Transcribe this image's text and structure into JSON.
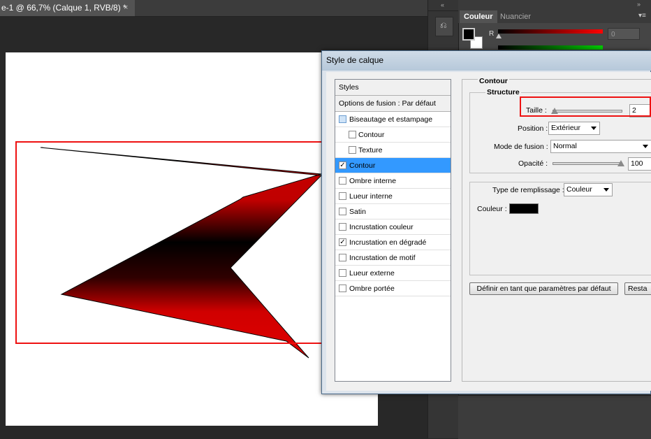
{
  "document": {
    "tab_title": "e-1 @ 66,7% (Calque 1, RVB/8) *",
    "close_glyph": "×"
  },
  "panel": {
    "tabs": [
      "Couleur",
      "Nuancier"
    ],
    "channel_r_label": "R",
    "channel_r_value": "0",
    "menu_icon": "panel-menu-icon",
    "collapse_icon": "double-chevron-icon"
  },
  "dialog": {
    "title": "Style de calque",
    "list": {
      "styles_header": "Styles",
      "blend_options": "Options de fusion : Par défaut",
      "items": [
        {
          "label": "Biseautage et estampage",
          "checked": false,
          "sub": false
        },
        {
          "label": "Contour",
          "checked": false,
          "sub": true
        },
        {
          "label": "Texture",
          "checked": false,
          "sub": true
        },
        {
          "label": "Contour",
          "checked": true,
          "sub": false,
          "selected": true
        },
        {
          "label": "Ombre interne",
          "checked": false,
          "sub": false
        },
        {
          "label": "Lueur interne",
          "checked": false,
          "sub": false
        },
        {
          "label": "Satin",
          "checked": false,
          "sub": false
        },
        {
          "label": "Incrustation couleur",
          "checked": false,
          "sub": false
        },
        {
          "label": "Incrustation en dégradé",
          "checked": true,
          "sub": false
        },
        {
          "label": "Incrustation de motif",
          "checked": false,
          "sub": false
        },
        {
          "label": "Lueur externe",
          "checked": false,
          "sub": false
        },
        {
          "label": "Ombre portée",
          "checked": false,
          "sub": false
        }
      ]
    },
    "contour": {
      "section_title": "Contour",
      "structure_title": "Structure",
      "size_label": "Taille :",
      "size_value": "2",
      "size_fraction": 0.0,
      "position_label": "Position :",
      "position_value": "Extérieur",
      "blend_label": "Mode de fusion :",
      "blend_value": "Normal",
      "opacity_label": "Opacité :",
      "opacity_value": "100",
      "opacity_fraction": 1.0,
      "fill_type_label": "Type de remplissage :",
      "fill_type_value": "Couleur",
      "color_label": "Couleur :",
      "color_value": "#000000",
      "default_button": "Définir en tant que paramètres par défaut",
      "reset_button": "Resta"
    }
  },
  "colors": {
    "highlight": "#e11111",
    "selection": "#3399ff",
    "shape_red": "#c80000"
  }
}
